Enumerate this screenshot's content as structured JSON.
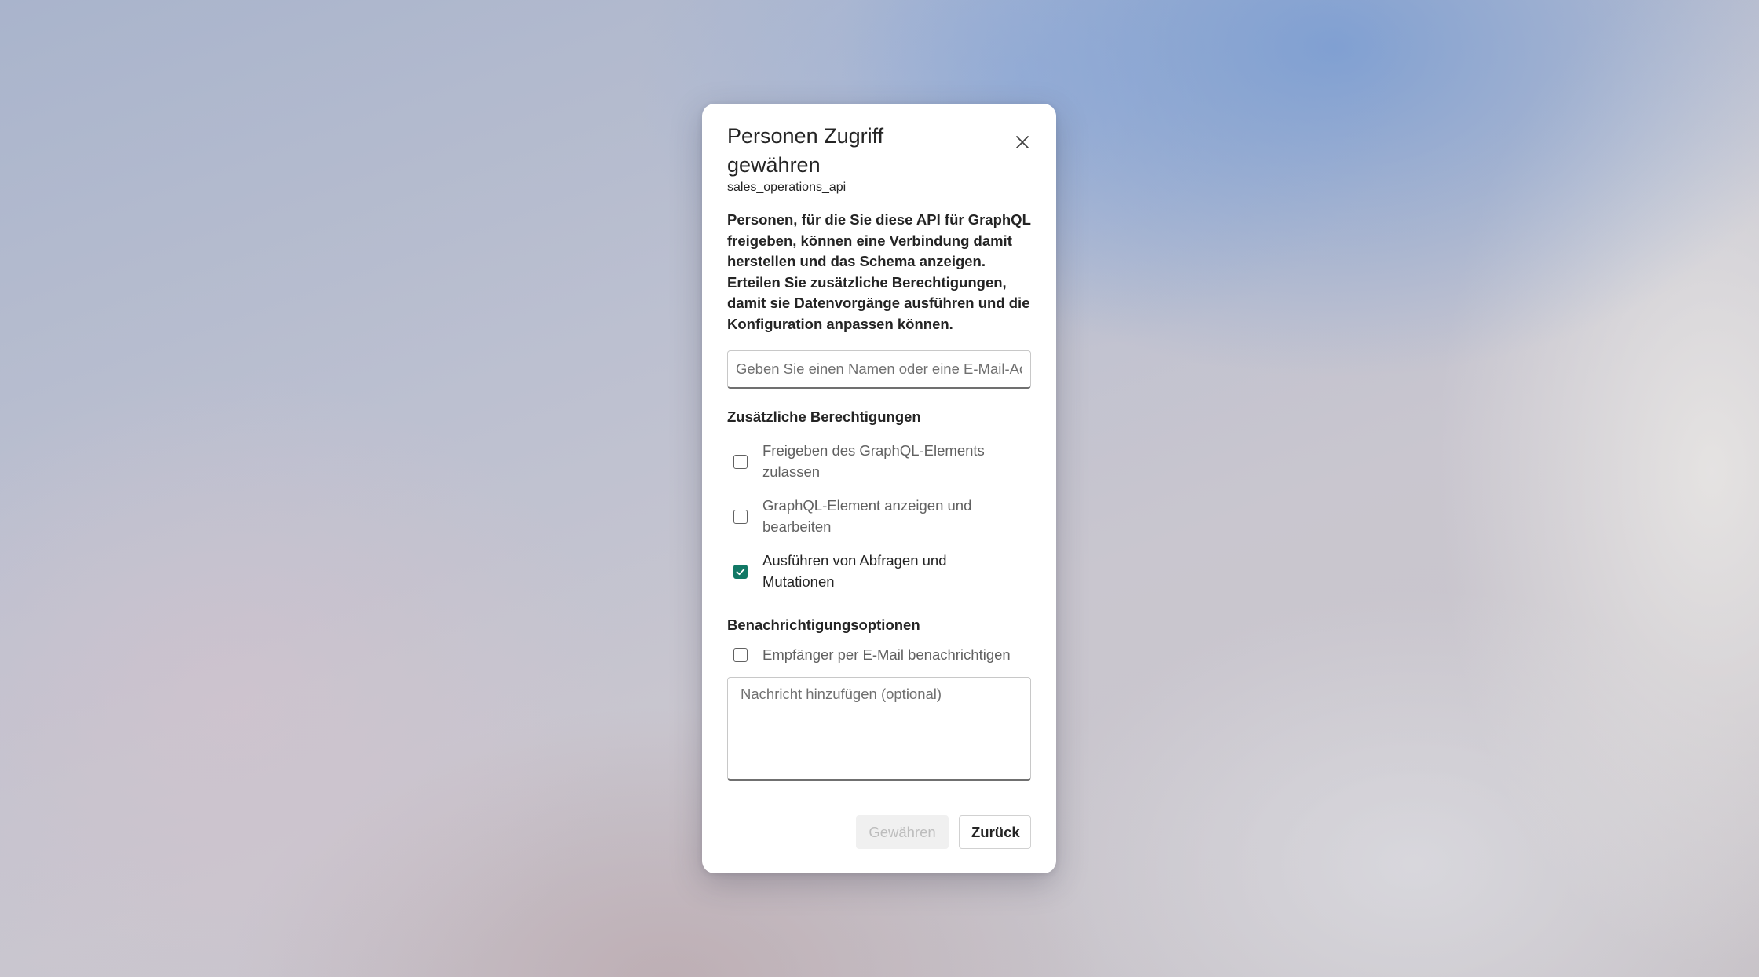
{
  "dialog": {
    "title": "Personen Zugriff gewähren",
    "subtitle": "sales_operations_api",
    "close_icon": "close-icon",
    "description": "Personen, für die Sie diese API für GraphQL freigeben, können eine Verbindung damit herstellen und das Schema anzeigen. Erteilen Sie zusätzliche Berechtigungen, damit sie Datenvorgänge ausführen und die Konfiguration anpassen können.",
    "name_input": {
      "placeholder": "Geben Sie einen Namen oder eine E-Mail-Adresse ein",
      "value": ""
    },
    "permissions": {
      "label": "Zusätzliche Berechtigungen",
      "items": [
        {
          "label": "Freigeben des GraphQL-Elements zulassen",
          "checked": false
        },
        {
          "label": "GraphQL-Element anzeigen und bearbeiten",
          "checked": false
        },
        {
          "label": "Ausführen von Abfragen und Mutationen",
          "checked": true
        }
      ]
    },
    "notifications": {
      "label": "Benachrichtigungsoptionen",
      "email_label": "Empfänger per E-Mail benachrichtigen",
      "email_checked": false,
      "message_placeholder": "Nachricht hinzufügen (optional)",
      "message_value": ""
    },
    "footer": {
      "grant_label": "Gewähren",
      "grant_disabled": true,
      "back_label": "Zurück"
    }
  },
  "colors": {
    "accent": "#117865",
    "text": "#242424",
    "muted_text": "#616161",
    "disabled_text": "#bdbdbd"
  }
}
